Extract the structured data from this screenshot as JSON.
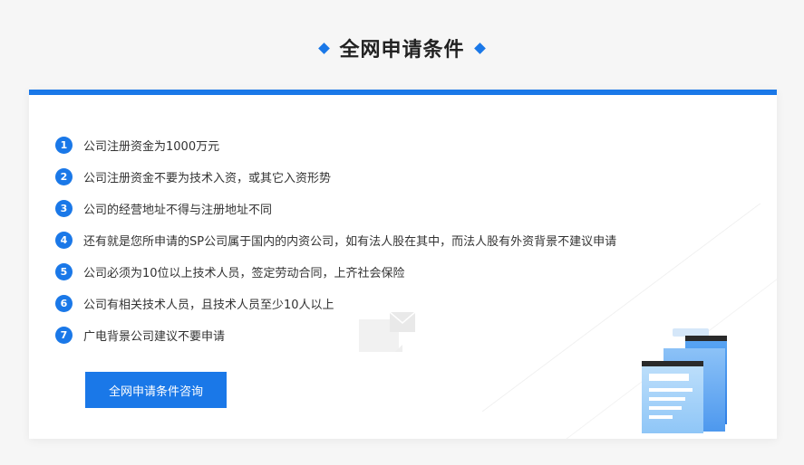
{
  "section": {
    "title": "全网申请条件"
  },
  "conditions": [
    {
      "num": "1",
      "text": "公司注册资金为1000万元"
    },
    {
      "num": "2",
      "text": "公司注册资金不要为技术入资，或其它入资形势"
    },
    {
      "num": "3",
      "text": "公司的经营地址不得与注册地址不同"
    },
    {
      "num": "4",
      "text": "还有就是您所申请的SP公司属于国内的内资公司，如有法人股在其中，而法人股有外资背景不建议申请"
    },
    {
      "num": "5",
      "text": "公司必须为10位以上技术人员，签定劳动合同，上齐社会保险"
    },
    {
      "num": "6",
      "text": "公司有相关技术人员，且技术人员至少10人以上"
    },
    {
      "num": "7",
      "text": "广电背景公司建议不要申请"
    }
  ],
  "consult_button": {
    "label": "全网申请条件咨询"
  },
  "colors": {
    "accent": "#1a78e8",
    "background": "#f6f6f6",
    "card": "#ffffff",
    "text": "#333333"
  },
  "icons": [
    "diamond-icon",
    "envelope-icon",
    "clipboard-illustration"
  ]
}
